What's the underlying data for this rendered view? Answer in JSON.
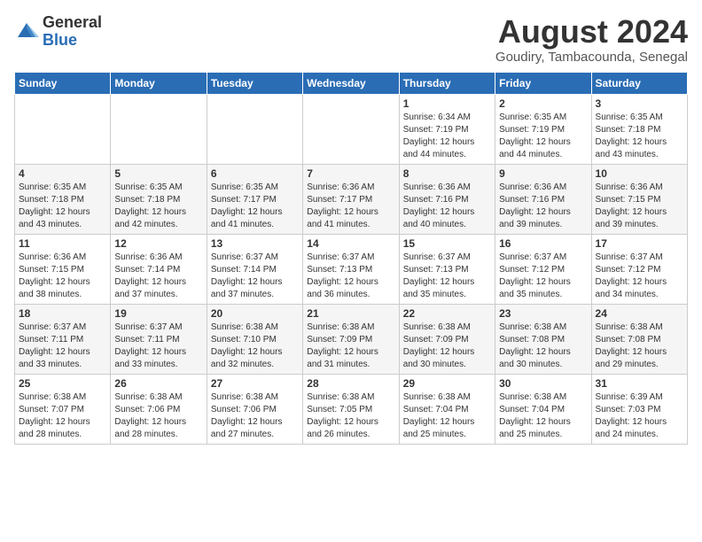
{
  "header": {
    "logo_general": "General",
    "logo_blue": "Blue",
    "month_year": "August 2024",
    "location": "Goudiry, Tambacounda, Senegal"
  },
  "weekdays": [
    "Sunday",
    "Monday",
    "Tuesday",
    "Wednesday",
    "Thursday",
    "Friday",
    "Saturday"
  ],
  "weeks": [
    [
      {
        "day": "",
        "info": ""
      },
      {
        "day": "",
        "info": ""
      },
      {
        "day": "",
        "info": ""
      },
      {
        "day": "",
        "info": ""
      },
      {
        "day": "1",
        "info": "Sunrise: 6:34 AM\nSunset: 7:19 PM\nDaylight: 12 hours\nand 44 minutes."
      },
      {
        "day": "2",
        "info": "Sunrise: 6:35 AM\nSunset: 7:19 PM\nDaylight: 12 hours\nand 44 minutes."
      },
      {
        "day": "3",
        "info": "Sunrise: 6:35 AM\nSunset: 7:18 PM\nDaylight: 12 hours\nand 43 minutes."
      }
    ],
    [
      {
        "day": "4",
        "info": "Sunrise: 6:35 AM\nSunset: 7:18 PM\nDaylight: 12 hours\nand 43 minutes."
      },
      {
        "day": "5",
        "info": "Sunrise: 6:35 AM\nSunset: 7:18 PM\nDaylight: 12 hours\nand 42 minutes."
      },
      {
        "day": "6",
        "info": "Sunrise: 6:35 AM\nSunset: 7:17 PM\nDaylight: 12 hours\nand 41 minutes."
      },
      {
        "day": "7",
        "info": "Sunrise: 6:36 AM\nSunset: 7:17 PM\nDaylight: 12 hours\nand 41 minutes."
      },
      {
        "day": "8",
        "info": "Sunrise: 6:36 AM\nSunset: 7:16 PM\nDaylight: 12 hours\nand 40 minutes."
      },
      {
        "day": "9",
        "info": "Sunrise: 6:36 AM\nSunset: 7:16 PM\nDaylight: 12 hours\nand 39 minutes."
      },
      {
        "day": "10",
        "info": "Sunrise: 6:36 AM\nSunset: 7:15 PM\nDaylight: 12 hours\nand 39 minutes."
      }
    ],
    [
      {
        "day": "11",
        "info": "Sunrise: 6:36 AM\nSunset: 7:15 PM\nDaylight: 12 hours\nand 38 minutes."
      },
      {
        "day": "12",
        "info": "Sunrise: 6:36 AM\nSunset: 7:14 PM\nDaylight: 12 hours\nand 37 minutes."
      },
      {
        "day": "13",
        "info": "Sunrise: 6:37 AM\nSunset: 7:14 PM\nDaylight: 12 hours\nand 37 minutes."
      },
      {
        "day": "14",
        "info": "Sunrise: 6:37 AM\nSunset: 7:13 PM\nDaylight: 12 hours\nand 36 minutes."
      },
      {
        "day": "15",
        "info": "Sunrise: 6:37 AM\nSunset: 7:13 PM\nDaylight: 12 hours\nand 35 minutes."
      },
      {
        "day": "16",
        "info": "Sunrise: 6:37 AM\nSunset: 7:12 PM\nDaylight: 12 hours\nand 35 minutes."
      },
      {
        "day": "17",
        "info": "Sunrise: 6:37 AM\nSunset: 7:12 PM\nDaylight: 12 hours\nand 34 minutes."
      }
    ],
    [
      {
        "day": "18",
        "info": "Sunrise: 6:37 AM\nSunset: 7:11 PM\nDaylight: 12 hours\nand 33 minutes."
      },
      {
        "day": "19",
        "info": "Sunrise: 6:37 AM\nSunset: 7:11 PM\nDaylight: 12 hours\nand 33 minutes."
      },
      {
        "day": "20",
        "info": "Sunrise: 6:38 AM\nSunset: 7:10 PM\nDaylight: 12 hours\nand 32 minutes."
      },
      {
        "day": "21",
        "info": "Sunrise: 6:38 AM\nSunset: 7:09 PM\nDaylight: 12 hours\nand 31 minutes."
      },
      {
        "day": "22",
        "info": "Sunrise: 6:38 AM\nSunset: 7:09 PM\nDaylight: 12 hours\nand 30 minutes."
      },
      {
        "day": "23",
        "info": "Sunrise: 6:38 AM\nSunset: 7:08 PM\nDaylight: 12 hours\nand 30 minutes."
      },
      {
        "day": "24",
        "info": "Sunrise: 6:38 AM\nSunset: 7:08 PM\nDaylight: 12 hours\nand 29 minutes."
      }
    ],
    [
      {
        "day": "25",
        "info": "Sunrise: 6:38 AM\nSunset: 7:07 PM\nDaylight: 12 hours\nand 28 minutes."
      },
      {
        "day": "26",
        "info": "Sunrise: 6:38 AM\nSunset: 7:06 PM\nDaylight: 12 hours\nand 28 minutes."
      },
      {
        "day": "27",
        "info": "Sunrise: 6:38 AM\nSunset: 7:06 PM\nDaylight: 12 hours\nand 27 minutes."
      },
      {
        "day": "28",
        "info": "Sunrise: 6:38 AM\nSunset: 7:05 PM\nDaylight: 12 hours\nand 26 minutes."
      },
      {
        "day": "29",
        "info": "Sunrise: 6:38 AM\nSunset: 7:04 PM\nDaylight: 12 hours\nand 25 minutes."
      },
      {
        "day": "30",
        "info": "Sunrise: 6:38 AM\nSunset: 7:04 PM\nDaylight: 12 hours\nand 25 minutes."
      },
      {
        "day": "31",
        "info": "Sunrise: 6:39 AM\nSunset: 7:03 PM\nDaylight: 12 hours\nand 24 minutes."
      }
    ]
  ]
}
